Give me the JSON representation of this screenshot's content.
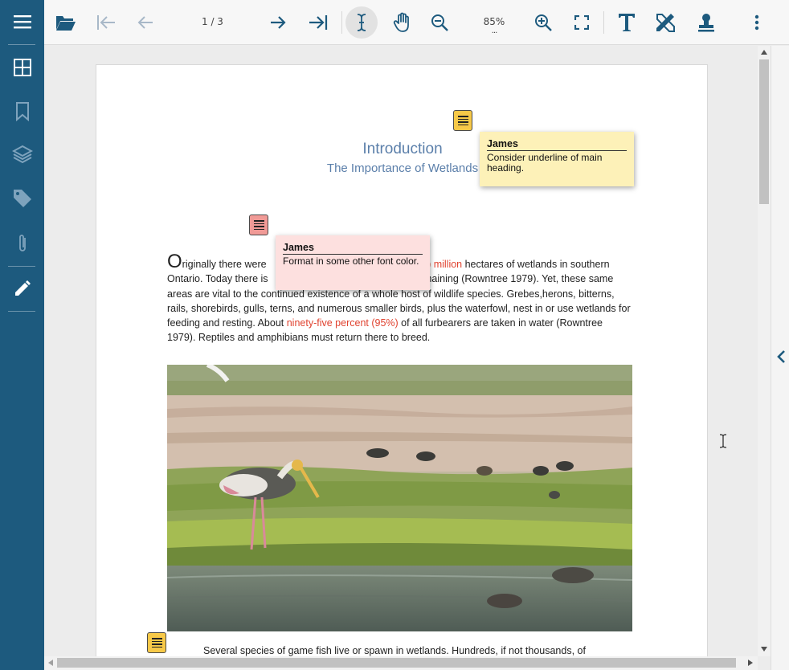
{
  "toolbar": {
    "page_indicator": "1 / 3",
    "zoom_level": "85%",
    "zoom_more": "..."
  },
  "document": {
    "title": "Introduction",
    "subtitle": "The Importance of Wetlands",
    "paragraph": {
      "drop_cap": "O",
      "seg1": "riginally there were ",
      "red1": ") million",
      "seg2": " hectares of wetlands in southern Ontario. Today there is ",
      "seg3": "maining (Rowntree 1979). Yet, these same areas are vital to the continued existence of a whole host of wildlife species. Grebes,herons, bitterns, rails, shorebirds, gulls, terns, and numerous smaller birds, plus the waterfowl, nest in or use wetlands for feeding and resting. About ",
      "red2": "ninety-five percent (95%)",
      "seg4": " of all furbearers are taken in water (Rowntree 1979). Reptiles and amphibians must return there to breed."
    },
    "bottom_text": "Several species of game fish live or spawn in wetlands. Hundreds, if not thousands, of"
  },
  "annotations": [
    {
      "author": "James",
      "message": "Consider underline of main heading.",
      "color": "#f7c948"
    },
    {
      "author": "James",
      "message": "Format in some other font color.",
      "color": "#f09a96"
    }
  ],
  "colors": {
    "sidebar": "#1d5a7e",
    "accent_text": "#5b7faa",
    "highlight_red": "#e0422f"
  }
}
